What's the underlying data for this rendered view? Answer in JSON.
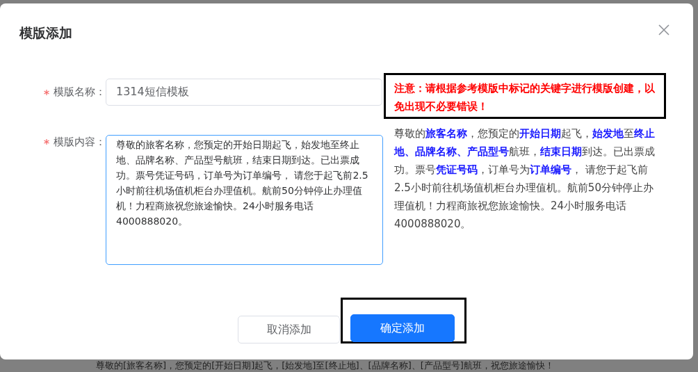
{
  "dialog": {
    "title": "模版添加",
    "fields": [
      {
        "label": "模版名称：",
        "required": true,
        "kind": "input",
        "value": "1314短信模板"
      },
      {
        "label": "模版内容：",
        "required": true,
        "kind": "textarea",
        "value": "尊敬的旅客名称，您预定的开始日期起飞，始发地至终止地、品牌名称、产品型号航班，结束日期到达。已出票成功。票号凭证号码，订单号为订单编号， 请您于起飞前2.5小时前往机场值机柜台办理值机。航前50分钟停止办理值机！力程商旅祝您旅途愉快。24小时服务电话4000888020。"
      }
    ],
    "notice": "注意：请根据参考模版中标记的关键字进行模版创建，以免出现不必要错误！",
    "reference": "尊敬的**旅客名称**，您预定的**开始日期**起飞，**始发地**至**终止地、品牌名称、产品型号**航班，**结束日期**到达。已出票成功。票号**凭证号码**，订单号为**订单编号**， 请您于起飞前2.5小时前往机场值机柜台办理值机。航前50分钟停止办理值机！力程商旅祝您旅途愉快。24小时服务电话4000888020。",
    "buttons": [
      {
        "label": "取消添加",
        "kind": "default"
      },
      {
        "label": "确定添加",
        "kind": "primary"
      }
    ]
  },
  "background_text": "尊敬的[旅客名称]，您预定的[开始日期]起飞，[始发地]至[终止地]、[品牌名称]、[产品型号]航班，祝您旅途愉快！"
}
